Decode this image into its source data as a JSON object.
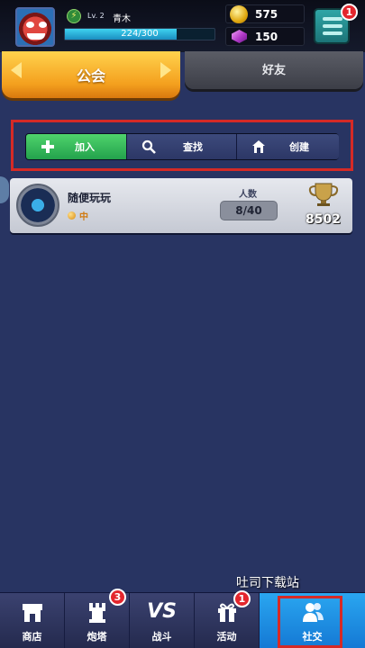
{
  "player": {
    "level_label": "Lv. 2",
    "name": "青木",
    "xp_text": "224/300",
    "xp_fraction": 0.7467
  },
  "resources": {
    "coins": "575",
    "gems": "150"
  },
  "menu": {
    "badge": "1"
  },
  "tabs": {
    "guild": "公会",
    "friends": "好友"
  },
  "actions": {
    "join": "加入",
    "search": "查找",
    "create": "创建"
  },
  "guild": {
    "name": "随便玩玩",
    "rank": "中",
    "members_label": "人数",
    "members": "8/40",
    "trophies": "8502"
  },
  "watermark": "吐司下载站",
  "nav": {
    "shop": "商店",
    "tower": "炮塔",
    "tower_badge": "3",
    "battle": "战斗",
    "battle_icon_text": "VS",
    "event": "活动",
    "event_badge": "1",
    "social": "社交"
  },
  "colors": {
    "background": "#283462",
    "join_green": "#23a24c",
    "tab_active": "#f4a01e",
    "social_blue": "#1478d4",
    "highlight_red": "#d52a26"
  }
}
